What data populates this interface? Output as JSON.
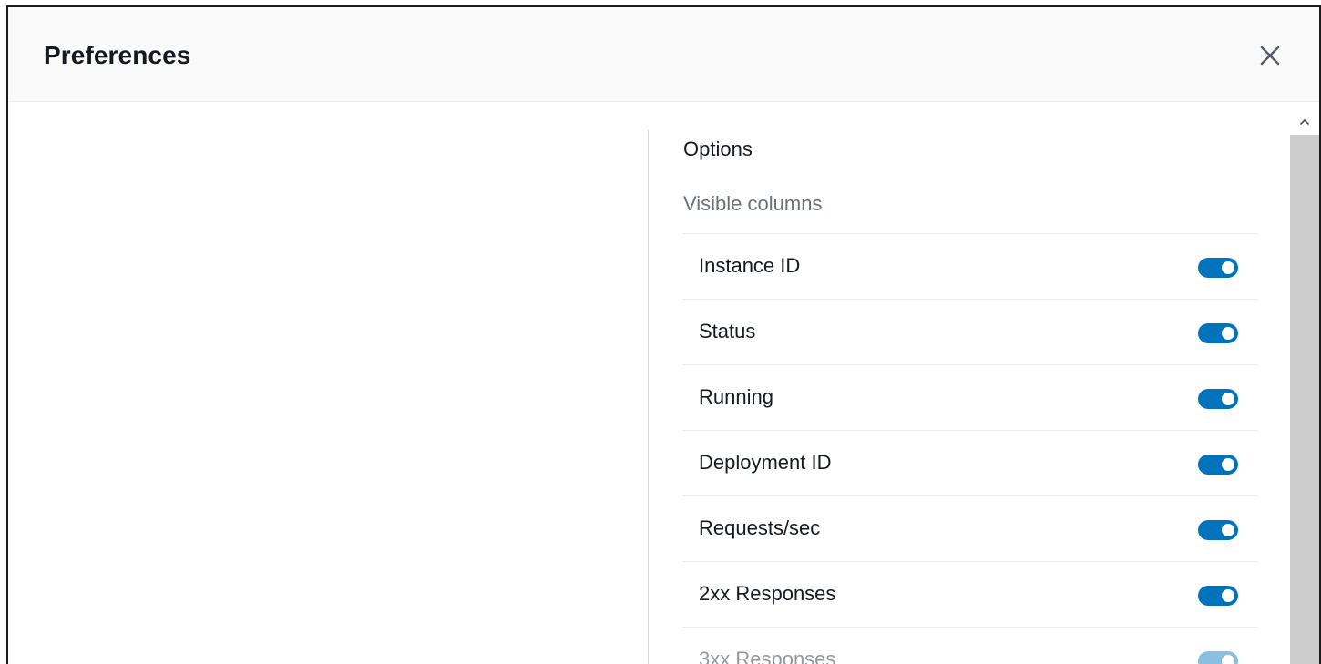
{
  "dialog": {
    "title": "Preferences",
    "close_icon": "close-icon"
  },
  "options": {
    "title": "Options",
    "visible_columns_label": "Visible columns",
    "columns": [
      {
        "label": "Instance ID",
        "enabled": true
      },
      {
        "label": "Status",
        "enabled": true
      },
      {
        "label": "Running",
        "enabled": true
      },
      {
        "label": "Deployment ID",
        "enabled": true
      },
      {
        "label": "Requests/sec",
        "enabled": true
      },
      {
        "label": "2xx Responses",
        "enabled": true
      },
      {
        "label": "3xx Responses",
        "enabled": true
      }
    ]
  },
  "colors": {
    "toggle_on": "#0073bb",
    "header_bg": "#fafafa",
    "scroll_thumb": "#cdcdcd"
  },
  "scrollbar": {
    "up_icon": "chevron-up-icon"
  }
}
